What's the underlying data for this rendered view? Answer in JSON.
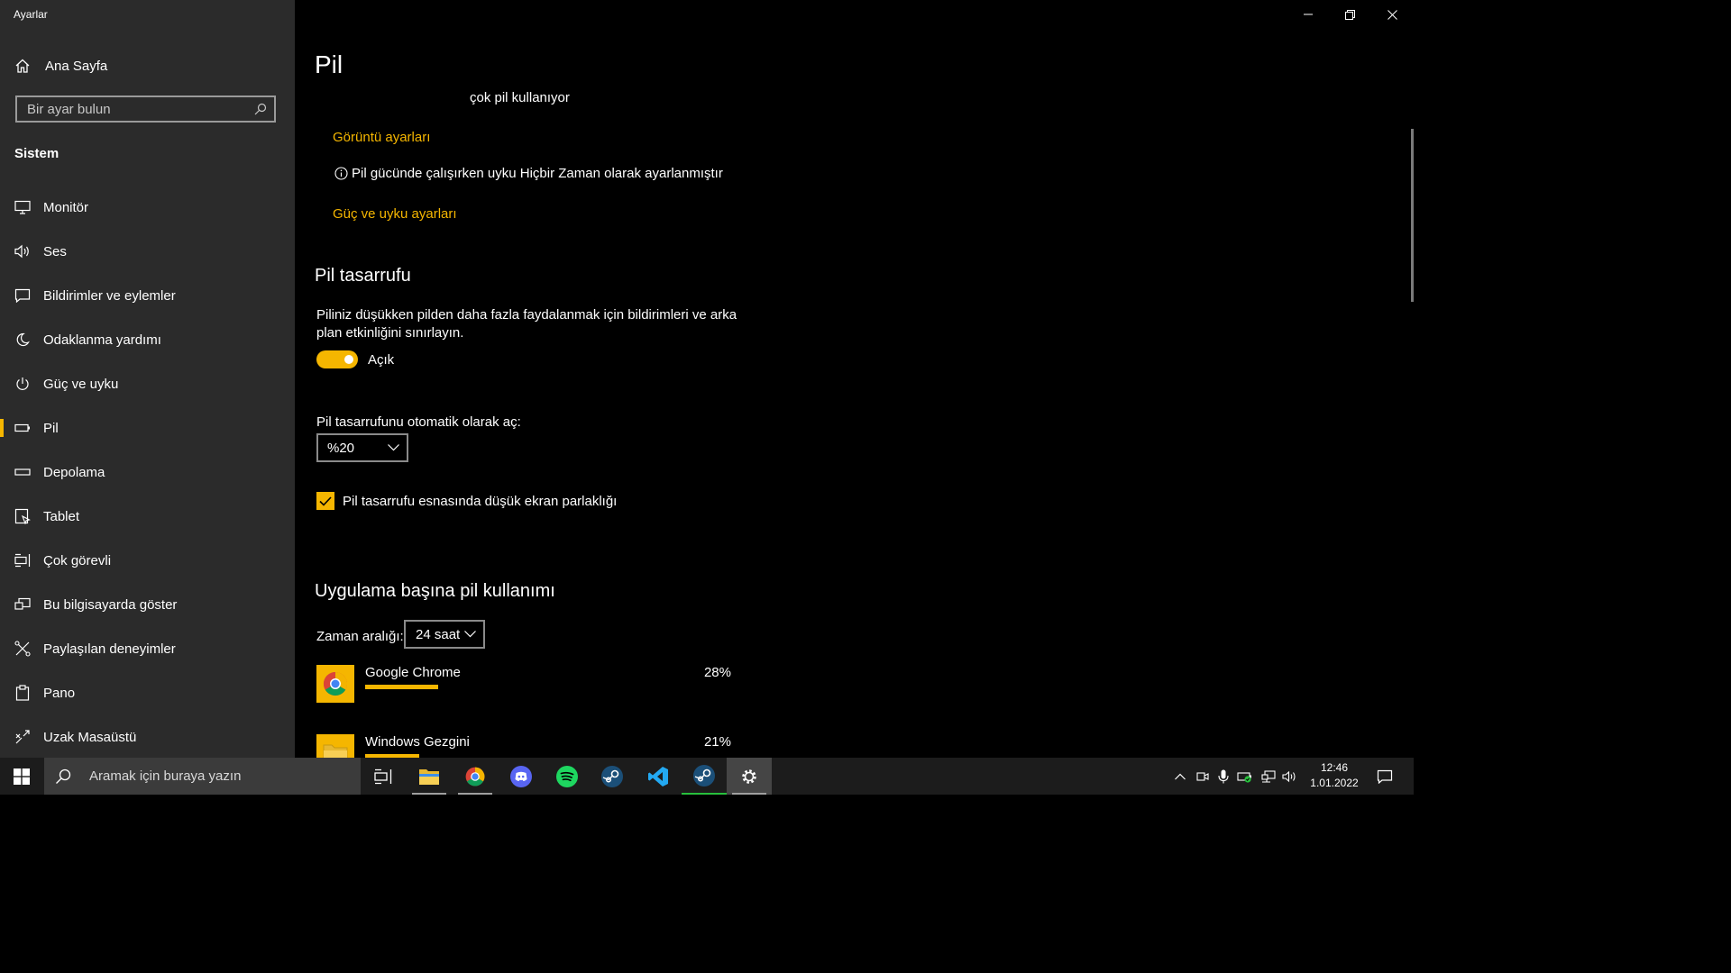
{
  "window": {
    "title": "Ayarlar",
    "accent_color": "#f5b600"
  },
  "sidebar": {
    "home_label": "Ana Sayfa",
    "search_placeholder": "Bir ayar bulun",
    "section_title": "Sistem",
    "items": [
      {
        "label": "Monitör",
        "icon": "monitor-icon"
      },
      {
        "label": "Ses",
        "icon": "speaker-icon"
      },
      {
        "label": "Bildirimler ve eylemler",
        "icon": "notification-icon"
      },
      {
        "label": "Odaklanma yardımı",
        "icon": "moon-icon"
      },
      {
        "label": "Güç ve uyku",
        "icon": "power-icon"
      },
      {
        "label": "Pil",
        "icon": "battery-icon",
        "active": true
      },
      {
        "label": "Depolama",
        "icon": "storage-icon"
      },
      {
        "label": "Tablet",
        "icon": "tablet-icon"
      },
      {
        "label": "Çok görevli",
        "icon": "multitask-icon"
      },
      {
        "label": "Bu bilgisayarda göster",
        "icon": "project-icon"
      },
      {
        "label": "Paylaşılan deneyimler",
        "icon": "shared-icon"
      },
      {
        "label": "Pano",
        "icon": "clipboard-icon"
      },
      {
        "label": "Uzak Masaüstü",
        "icon": "remote-desktop-icon"
      }
    ]
  },
  "main": {
    "title": "Pil",
    "usage_note": "çok pil kullanıyor",
    "display_settings_link": "Görüntü ayarları",
    "sleep_info": "Pil gücünde çalışırken uyku Hiçbir Zaman olarak ayarlanmıştır",
    "power_sleep_link": "Güç ve uyku ayarları",
    "saver": {
      "heading": "Pil tasarrufu",
      "description_line1": "Piliniz düşükken pilden daha fazla faydalanmak için bildirimleri ve arka",
      "description_line2": "plan etkinliğini sınırlayın.",
      "toggle_state": "Açık",
      "auto_label": "Pil tasarrufunu otomatik olarak aç:",
      "auto_value": "%20",
      "brightness_label": "Pil tasarrufu esnasında düşük ekran parlaklığı"
    },
    "per_app": {
      "heading": "Uygulama başına pil kullanımı",
      "range_label": "Zaman aralığı:",
      "range_value": "24 saat",
      "apps": [
        {
          "name": "Google Chrome",
          "percent": "28%",
          "fraction": 0.28
        },
        {
          "name": "Windows Gezgini",
          "percent": "21%",
          "fraction": 0.21
        }
      ]
    }
  },
  "taskbar": {
    "search_placeholder": "Aramak için buraya yazın",
    "apps": [
      "task-view",
      "file-explorer",
      "chrome",
      "discord",
      "spotify",
      "steam",
      "vscode",
      "steam",
      "settings"
    ],
    "time": "12:46",
    "date": "1.01.2022"
  }
}
